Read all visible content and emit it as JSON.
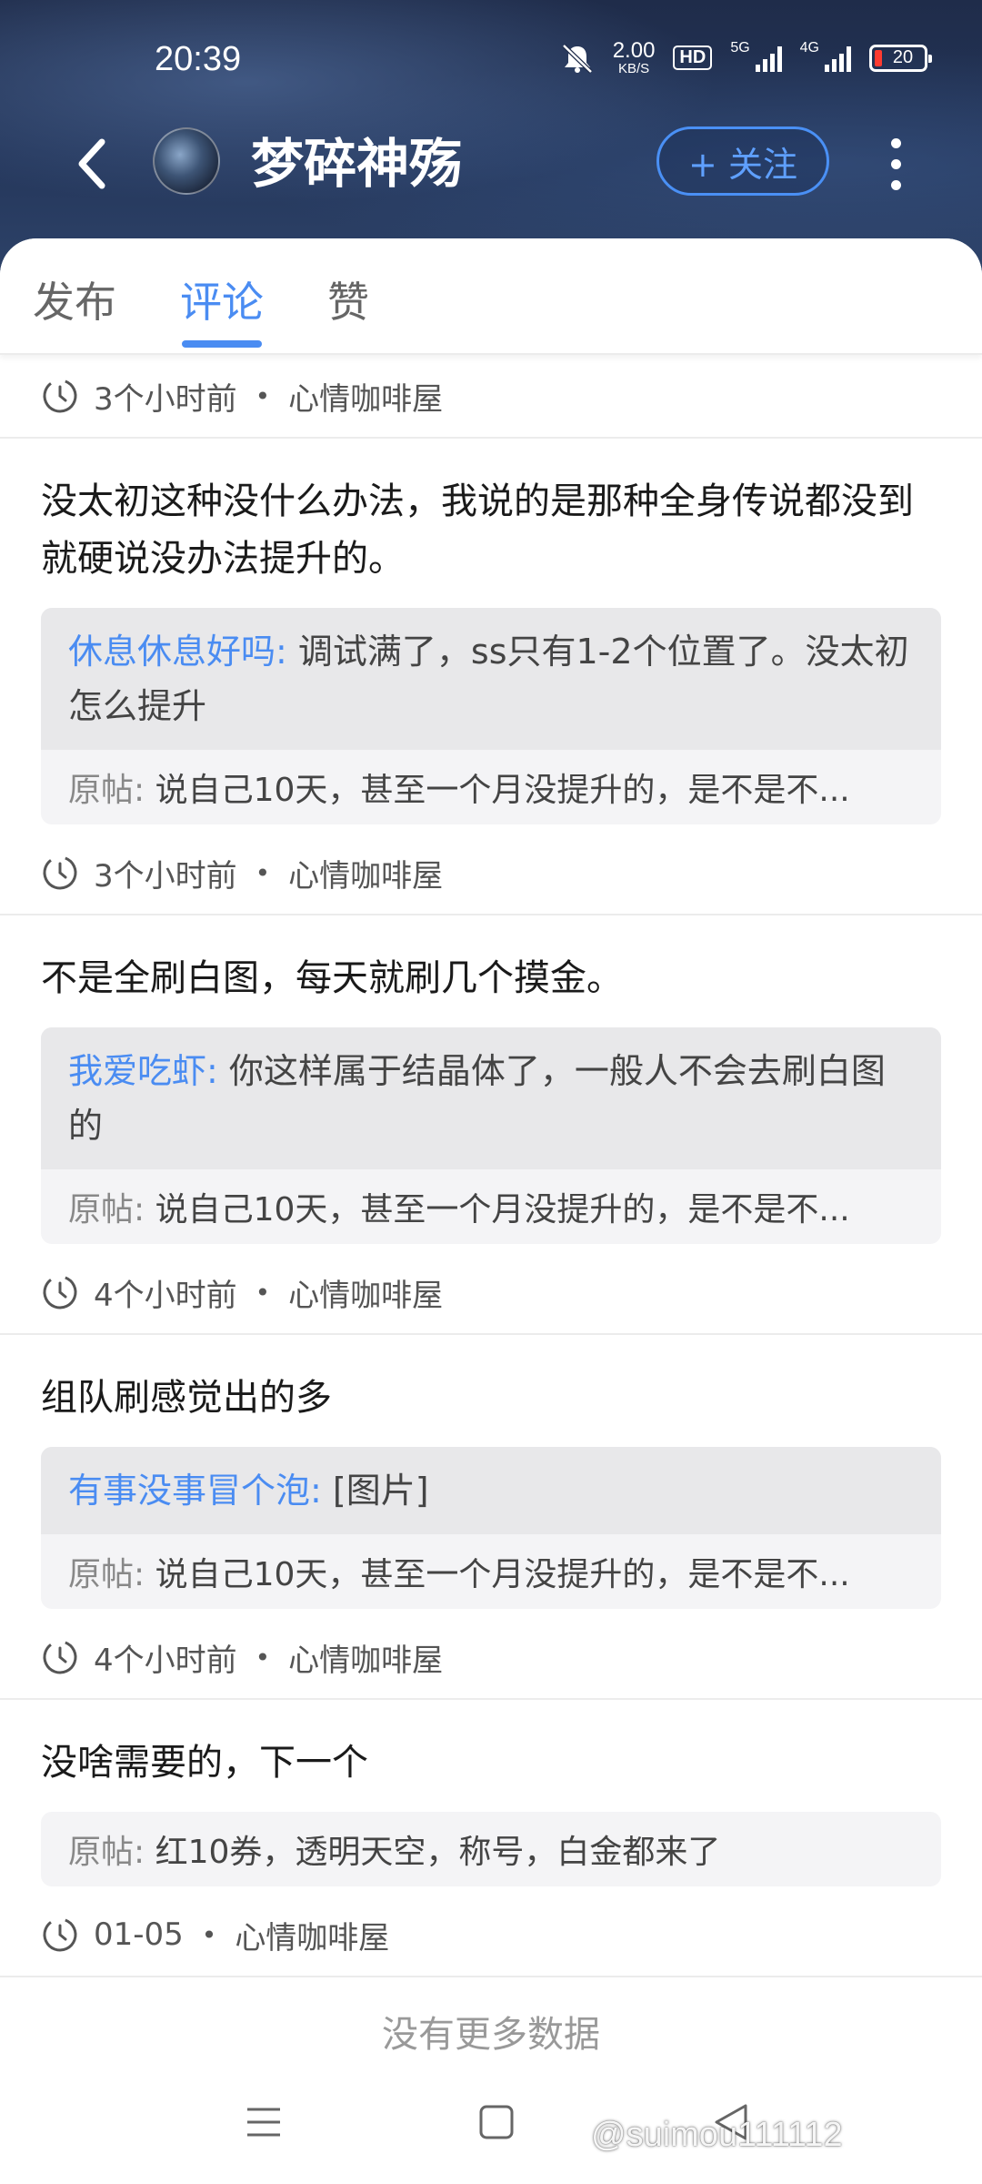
{
  "status_bar": {
    "time": "20:39",
    "speed_value": "2.00",
    "speed_unit": "KB/S",
    "hd_label": "HD",
    "net1": "5G",
    "net2": "4G",
    "battery": "20"
  },
  "header": {
    "title": "梦碎神殇",
    "follow_label": "+ 关注"
  },
  "tabs": [
    {
      "label": "发布",
      "active": false
    },
    {
      "label": "评论",
      "active": true
    },
    {
      "label": "赞",
      "active": false
    }
  ],
  "first_meta": {
    "time": "3个小时前",
    "forum": "心情咖啡屋"
  },
  "comments": [
    {
      "text": "没太初这种没什么办法，我说的是那种全身传说都没到就硬说没办法提升的。",
      "reply_author": "休息休息好吗:",
      "reply_text": "调试满了，ss只有1-2个位置了。没太初怎么提升",
      "orig_label": "原帖:",
      "orig_text": "说自己10天，甚至一个月没提升的，是不是不...",
      "time": "3个小时前",
      "forum": "心情咖啡屋"
    },
    {
      "text": "不是全刷白图，每天就刷几个摸金。",
      "reply_author": "我爱吃虾:",
      "reply_text": "你这样属于结晶体了，一般人不会去刷白图的",
      "orig_label": "原帖:",
      "orig_text": "说自己10天，甚至一个月没提升的，是不是不...",
      "time": "4个小时前",
      "forum": "心情咖啡屋"
    },
    {
      "text": "组队刷感觉出的多",
      "reply_author": "有事没事冒个泡:",
      "reply_text": "[图片]",
      "orig_label": "原帖:",
      "orig_text": "说自己10天，甚至一个月没提升的，是不是不...",
      "time": "4个小时前",
      "forum": "心情咖啡屋"
    },
    {
      "text": "没啥需要的，下一个",
      "orig_label": "原帖:",
      "orig_text": "红10券，透明天空，称号，白金都来了",
      "time": "01-05",
      "forum": "心情咖啡屋"
    }
  ],
  "no_more": "没有更多数据",
  "watermark": "@suimou111112",
  "colors": {
    "accent": "#4a8cf2",
    "header_bg": "#24365a",
    "battery_low": "#ff3b30"
  },
  "icons": [
    "back-arrow-icon",
    "more-vertical-icon",
    "clock-icon",
    "menu-key-icon",
    "home-key-icon",
    "back-key-icon",
    "mute-bell-icon"
  ]
}
